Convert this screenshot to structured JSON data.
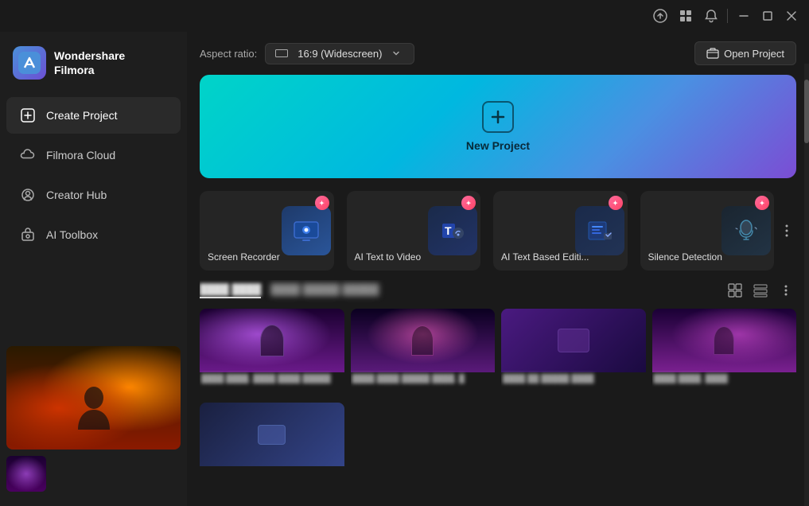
{
  "window": {
    "title": "Wondershare Filmora"
  },
  "titlebar": {
    "upload_icon": "⬆",
    "grid_icon": "⊞",
    "bell_icon": "🔔",
    "minimize": "—",
    "maximize": "❐",
    "close": "✕"
  },
  "sidebar": {
    "logo_text_line1": "Wondershare",
    "logo_text_line2": "Filmora",
    "nav_items": [
      {
        "id": "create-project",
        "label": "Create Project",
        "icon": "＋",
        "active": true
      },
      {
        "id": "filmora-cloud",
        "label": "Filmora Cloud",
        "icon": "☁"
      },
      {
        "id": "creator-hub",
        "label": "Creator Hub",
        "icon": "💡"
      },
      {
        "id": "ai-toolbox",
        "label": "AI Toolbox",
        "icon": "🤖"
      }
    ]
  },
  "topbar": {
    "aspect_ratio_label": "Aspect ratio:",
    "aspect_ratio_value": "16:9 (Widescreen)",
    "open_project_label": "Open Project"
  },
  "new_project": {
    "label": "New Project",
    "icon": "+"
  },
  "feature_cards": [
    {
      "id": "screen-recorder",
      "label": "Screen Recorder",
      "icon": "📷",
      "badge": true
    },
    {
      "id": "ai-text-to-video",
      "label": "AI Text to Video",
      "icon": "T",
      "badge": true
    },
    {
      "id": "ai-text-based-edit",
      "label": "AI Text Based Editi...",
      "icon": "✎",
      "badge": true
    },
    {
      "id": "silence-detection",
      "label": "Silence Detection",
      "icon": "🎧",
      "badge": true
    }
  ],
  "templates": {
    "tabs": [
      {
        "id": "tab1",
        "label": "████ ████",
        "active": true
      },
      {
        "id": "tab2",
        "label": "████ █████ █████"
      }
    ],
    "items": [
      {
        "id": "t1",
        "caption": "████ ████, ████ ████ █████"
      },
      {
        "id": "t2",
        "caption": "████ ████ █████ ████, █"
      },
      {
        "id": "t3",
        "caption": "████ ██ █████ ████"
      },
      {
        "id": "t4",
        "caption": "████ ████, ████"
      },
      {
        "id": "t5",
        "caption": "████ ████ ████"
      }
    ]
  }
}
